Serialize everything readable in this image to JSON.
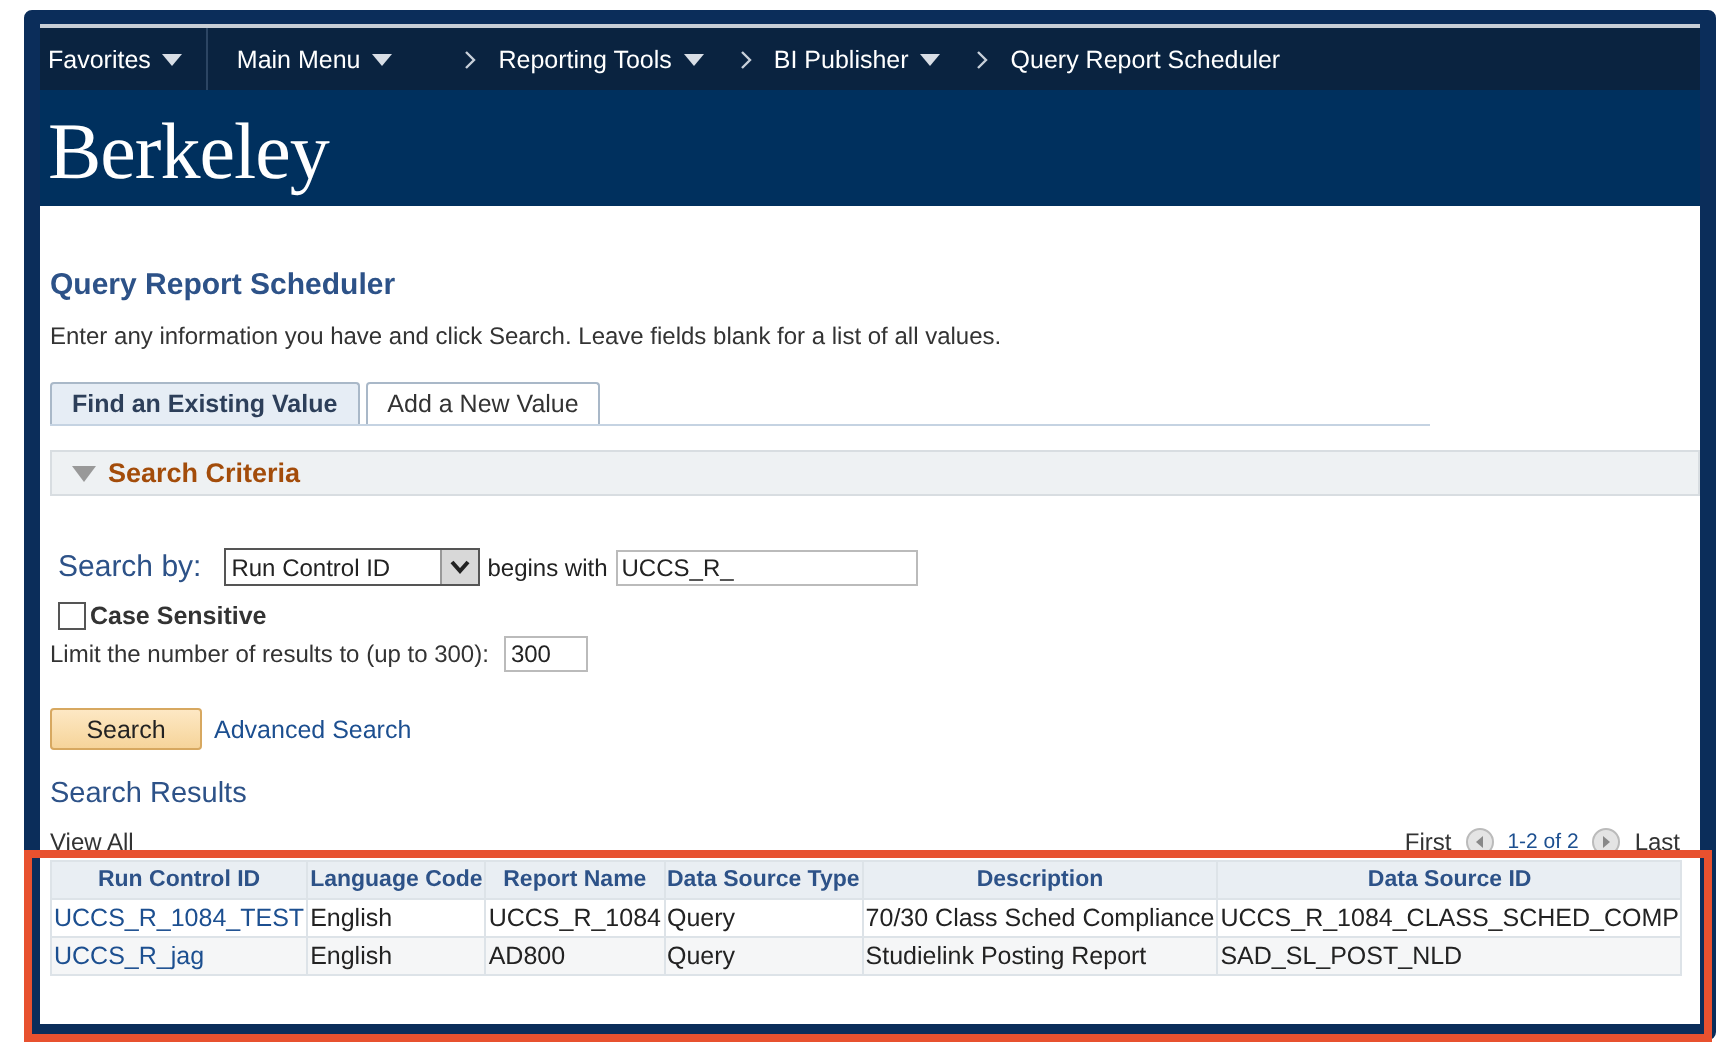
{
  "nav": {
    "items": [
      {
        "label": "Favorites",
        "kind": "menu"
      },
      {
        "label": "Main Menu",
        "kind": "menu"
      },
      {
        "label": "Reporting Tools",
        "kind": "crumb-menu"
      },
      {
        "label": "BI Publisher",
        "kind": "crumb-menu"
      },
      {
        "label": "Query Report Scheduler",
        "kind": "crumb"
      }
    ]
  },
  "banner": {
    "logo": "Berkeley"
  },
  "page": {
    "title": "Query Report Scheduler",
    "instructions": "Enter any information you have and click Search. Leave fields blank for a list of all values."
  },
  "tabs": [
    {
      "label": "Find an Existing Value",
      "selected": true
    },
    {
      "label": "Add a New Value",
      "selected": false
    }
  ],
  "criteria": {
    "header": "Search Criteria",
    "expanded": true,
    "search_by_label": "Search by:",
    "search_by": "Run Control ID",
    "operator": "begins with",
    "value": "UCCS_R_",
    "case_sensitive": {
      "label": "Case Sensitive",
      "checked": false
    },
    "limit_label": "Limit the number of results to (up to 300):",
    "limit": "300"
  },
  "actions": {
    "search": "Search",
    "advanced": "Advanced Search"
  },
  "results": {
    "title": "Search Results",
    "view_all": "View All",
    "first": "First",
    "range": "1-2 of 2",
    "last": "Last",
    "columns": [
      "Run Control ID",
      "Language Code",
      "Report Name",
      "Data Source Type",
      "Description",
      "Data Source ID"
    ],
    "rows": [
      [
        "UCCS_R_1084_TEST",
        "English",
        "UCCS_R_1084",
        "Query",
        "70/30 Class Sched Compliance",
        "UCCS_R_1084_CLASS_SCHED_COMP"
      ],
      [
        "UCCS_R_jag",
        "English",
        "AD800",
        "Query",
        "Studielink Posting Report",
        "SAD_SL_POST_NLD"
      ]
    ]
  }
}
